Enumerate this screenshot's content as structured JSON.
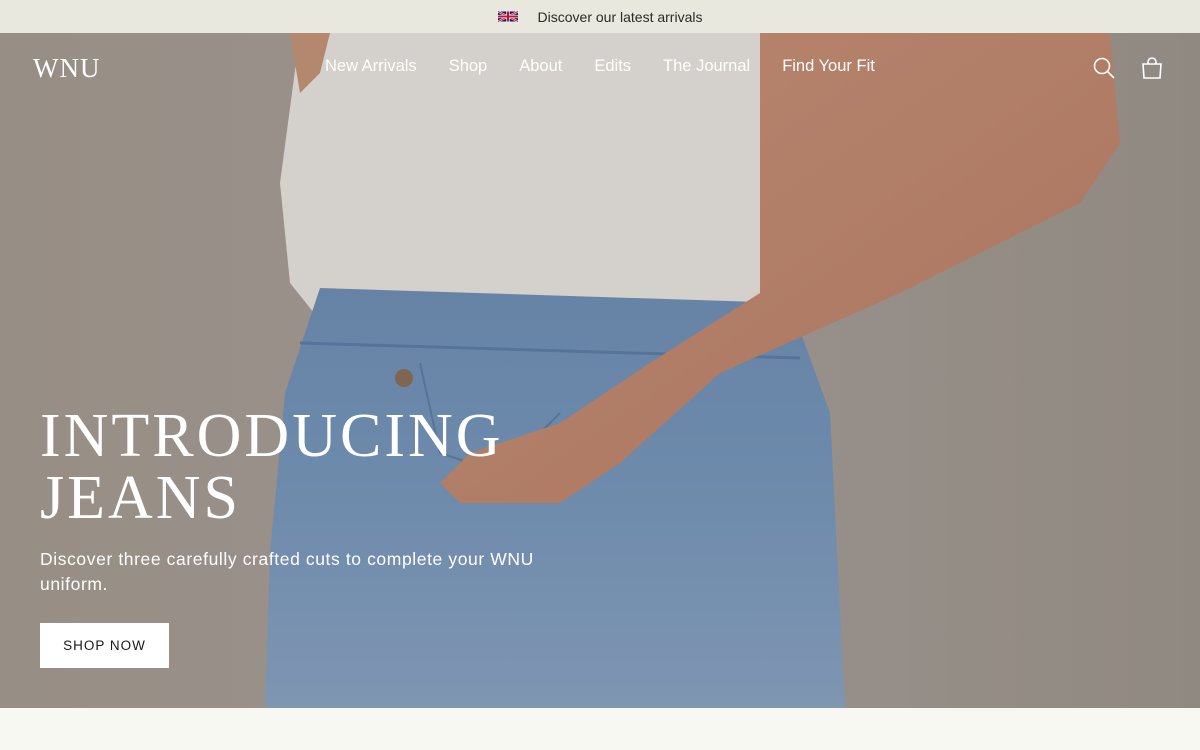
{
  "announcement": {
    "flag_icon": "uk-flag-icon",
    "text": "Discover our latest arrivals"
  },
  "header": {
    "logo": "WNU",
    "nav": [
      {
        "label": "New Arrivals"
      },
      {
        "label": "Shop"
      },
      {
        "label": "About"
      },
      {
        "label": "Edits"
      },
      {
        "label": "The Journal"
      },
      {
        "label": "Find Your Fit"
      }
    ],
    "icons": [
      "search-icon",
      "bag-icon"
    ]
  },
  "hero": {
    "headline_line1": "INTRODUCING",
    "headline_line2": "JEANS",
    "subcopy": "Discover three carefully crafted cuts to complete your WNU uniform.",
    "cta_label": "SHOP NOW",
    "colors": {
      "announcement_bg": "#e9e8de",
      "hero_text": "#ffffff",
      "cta_bg": "#ffffff",
      "cta_text": "#1a1a1a"
    }
  }
}
